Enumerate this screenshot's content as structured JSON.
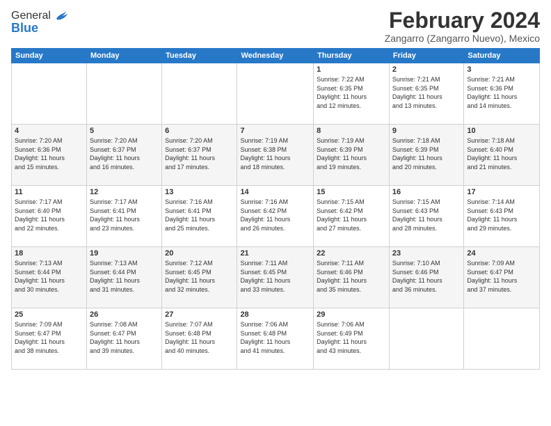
{
  "logo": {
    "general": "General",
    "blue": "Blue"
  },
  "header": {
    "title": "February 2024",
    "location": "Zangarro (Zangarro Nuevo), Mexico"
  },
  "weekdays": [
    "Sunday",
    "Monday",
    "Tuesday",
    "Wednesday",
    "Thursday",
    "Friday",
    "Saturday"
  ],
  "weeks": [
    [
      {
        "day": "",
        "info": ""
      },
      {
        "day": "",
        "info": ""
      },
      {
        "day": "",
        "info": ""
      },
      {
        "day": "",
        "info": ""
      },
      {
        "day": "1",
        "info": "Sunrise: 7:22 AM\nSunset: 6:35 PM\nDaylight: 11 hours\nand 12 minutes."
      },
      {
        "day": "2",
        "info": "Sunrise: 7:21 AM\nSunset: 6:35 PM\nDaylight: 11 hours\nand 13 minutes."
      },
      {
        "day": "3",
        "info": "Sunrise: 7:21 AM\nSunset: 6:36 PM\nDaylight: 11 hours\nand 14 minutes."
      }
    ],
    [
      {
        "day": "4",
        "info": "Sunrise: 7:20 AM\nSunset: 6:36 PM\nDaylight: 11 hours\nand 15 minutes."
      },
      {
        "day": "5",
        "info": "Sunrise: 7:20 AM\nSunset: 6:37 PM\nDaylight: 11 hours\nand 16 minutes."
      },
      {
        "day": "6",
        "info": "Sunrise: 7:20 AM\nSunset: 6:37 PM\nDaylight: 11 hours\nand 17 minutes."
      },
      {
        "day": "7",
        "info": "Sunrise: 7:19 AM\nSunset: 6:38 PM\nDaylight: 11 hours\nand 18 minutes."
      },
      {
        "day": "8",
        "info": "Sunrise: 7:19 AM\nSunset: 6:39 PM\nDaylight: 11 hours\nand 19 minutes."
      },
      {
        "day": "9",
        "info": "Sunrise: 7:18 AM\nSunset: 6:39 PM\nDaylight: 11 hours\nand 20 minutes."
      },
      {
        "day": "10",
        "info": "Sunrise: 7:18 AM\nSunset: 6:40 PM\nDaylight: 11 hours\nand 21 minutes."
      }
    ],
    [
      {
        "day": "11",
        "info": "Sunrise: 7:17 AM\nSunset: 6:40 PM\nDaylight: 11 hours\nand 22 minutes."
      },
      {
        "day": "12",
        "info": "Sunrise: 7:17 AM\nSunset: 6:41 PM\nDaylight: 11 hours\nand 23 minutes."
      },
      {
        "day": "13",
        "info": "Sunrise: 7:16 AM\nSunset: 6:41 PM\nDaylight: 11 hours\nand 25 minutes."
      },
      {
        "day": "14",
        "info": "Sunrise: 7:16 AM\nSunset: 6:42 PM\nDaylight: 11 hours\nand 26 minutes."
      },
      {
        "day": "15",
        "info": "Sunrise: 7:15 AM\nSunset: 6:42 PM\nDaylight: 11 hours\nand 27 minutes."
      },
      {
        "day": "16",
        "info": "Sunrise: 7:15 AM\nSunset: 6:43 PM\nDaylight: 11 hours\nand 28 minutes."
      },
      {
        "day": "17",
        "info": "Sunrise: 7:14 AM\nSunset: 6:43 PM\nDaylight: 11 hours\nand 29 minutes."
      }
    ],
    [
      {
        "day": "18",
        "info": "Sunrise: 7:13 AM\nSunset: 6:44 PM\nDaylight: 11 hours\nand 30 minutes."
      },
      {
        "day": "19",
        "info": "Sunrise: 7:13 AM\nSunset: 6:44 PM\nDaylight: 11 hours\nand 31 minutes."
      },
      {
        "day": "20",
        "info": "Sunrise: 7:12 AM\nSunset: 6:45 PM\nDaylight: 11 hours\nand 32 minutes."
      },
      {
        "day": "21",
        "info": "Sunrise: 7:11 AM\nSunset: 6:45 PM\nDaylight: 11 hours\nand 33 minutes."
      },
      {
        "day": "22",
        "info": "Sunrise: 7:11 AM\nSunset: 6:46 PM\nDaylight: 11 hours\nand 35 minutes."
      },
      {
        "day": "23",
        "info": "Sunrise: 7:10 AM\nSunset: 6:46 PM\nDaylight: 11 hours\nand 36 minutes."
      },
      {
        "day": "24",
        "info": "Sunrise: 7:09 AM\nSunset: 6:47 PM\nDaylight: 11 hours\nand 37 minutes."
      }
    ],
    [
      {
        "day": "25",
        "info": "Sunrise: 7:09 AM\nSunset: 6:47 PM\nDaylight: 11 hours\nand 38 minutes."
      },
      {
        "day": "26",
        "info": "Sunrise: 7:08 AM\nSunset: 6:47 PM\nDaylight: 11 hours\nand 39 minutes."
      },
      {
        "day": "27",
        "info": "Sunrise: 7:07 AM\nSunset: 6:48 PM\nDaylight: 11 hours\nand 40 minutes."
      },
      {
        "day": "28",
        "info": "Sunrise: 7:06 AM\nSunset: 6:48 PM\nDaylight: 11 hours\nand 41 minutes."
      },
      {
        "day": "29",
        "info": "Sunrise: 7:06 AM\nSunset: 6:49 PM\nDaylight: 11 hours\nand 43 minutes."
      },
      {
        "day": "",
        "info": ""
      },
      {
        "day": "",
        "info": ""
      }
    ]
  ]
}
